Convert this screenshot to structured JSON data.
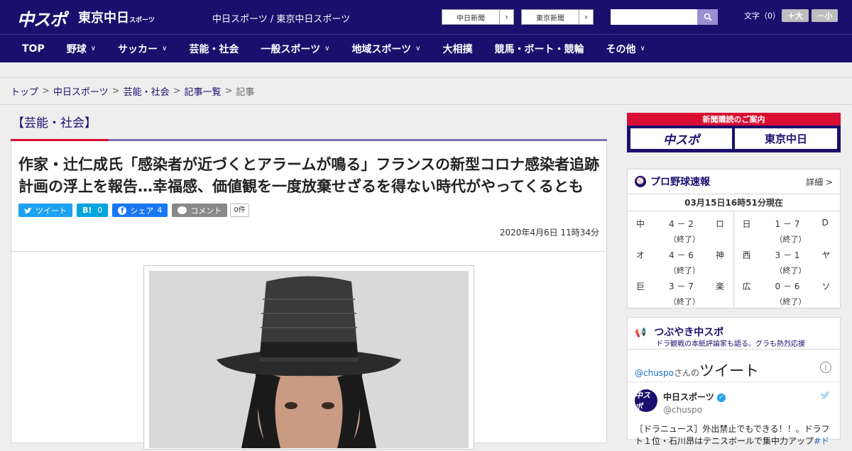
{
  "header": {
    "logo_chuspo": "中スポ",
    "logo_tokyo": "東京中日",
    "logo_tokyo_small": "スポーツ",
    "site_names": "中日スポーツ / 東京中日スポーツ",
    "link1": "中日新聞",
    "link2": "東京新聞",
    "search_placeholder": "",
    "font_label": "文字（0）",
    "font_bigger": "＋大",
    "font_smaller": "－小",
    "colors": {
      "navy": "#1b0f6e",
      "red": "#d90d32"
    }
  },
  "nav": {
    "items": [
      {
        "label": "TOP",
        "has_menu": false
      },
      {
        "label": "野球",
        "has_menu": true
      },
      {
        "label": "サッカー",
        "has_menu": true
      },
      {
        "label": "芸能・社会",
        "has_menu": false
      },
      {
        "label": "一般スポーツ",
        "has_menu": true
      },
      {
        "label": "地域スポーツ",
        "has_menu": true
      },
      {
        "label": "大相撲",
        "has_menu": false
      },
      {
        "label": "競馬・ボート・競輪",
        "has_menu": false
      },
      {
        "label": "その他",
        "has_menu": true
      }
    ]
  },
  "breadcrumb": [
    "トップ",
    "中日スポーツ",
    "芸能・社会",
    "記事一覧",
    "記事"
  ],
  "article": {
    "category": "【芸能・社会】",
    "title": "作家・辻仁成氏「感染者が近づくとアラームが鳴る」フランスの新型コロナ感染者追跡計画の浮上を報告…幸福感、価値観を一度放棄せざるを得ない時代がやってくるとも",
    "share": {
      "tweet": "ツイート",
      "hatena_icon": "B!",
      "hatena_count": "0",
      "facebook": "シェア",
      "facebook_count": "4",
      "comment": "コメント",
      "comment_count": "0件"
    },
    "date": "2020年4月6日 11時34分"
  },
  "sidebar": {
    "promo_head": "新聞購読のご案内",
    "promo_logo1": "中スポ",
    "promo_logo2": "東京中日",
    "baseball": {
      "title": "プロ野球速報",
      "more": "詳細 >",
      "stamp": "03月15日16時51分現在",
      "left": [
        {
          "a": "中",
          "score": "4 － 2",
          "b": "ロ",
          "status": "（終了）"
        },
        {
          "a": "オ",
          "score": "4 － 6",
          "b": "神",
          "status": "（終了）"
        },
        {
          "a": "巨",
          "score": "3 － 7",
          "b": "楽",
          "status": "（終了）"
        }
      ],
      "right": [
        {
          "a": "日",
          "score": "1 － 7",
          "b": "D",
          "status": "（終了）"
        },
        {
          "a": "西",
          "score": "3 － 1",
          "b": "ヤ",
          "status": "（終了）"
        },
        {
          "a": "広",
          "score": "0 － 6",
          "b": "ソ",
          "status": "（終了）"
        }
      ]
    },
    "twitter": {
      "title": "つぶやき中スポ",
      "sub": "ドラ観戦の本紙評論家も語る。グラも熱烈応援",
      "handle_link": "@chuspo",
      "handle_suffix": "さんの",
      "heading": "ツイート",
      "info": "i",
      "user_name": "中日スポーツ",
      "user_handle": "@chuspo",
      "avatar_text": "中スポ",
      "tweet_text": "［ドラニュース］外出禁止でもできる！！。ドラフト１位・石川昂はテニスボールで集中力アップ",
      "tweet_tag": "#ド"
    }
  }
}
